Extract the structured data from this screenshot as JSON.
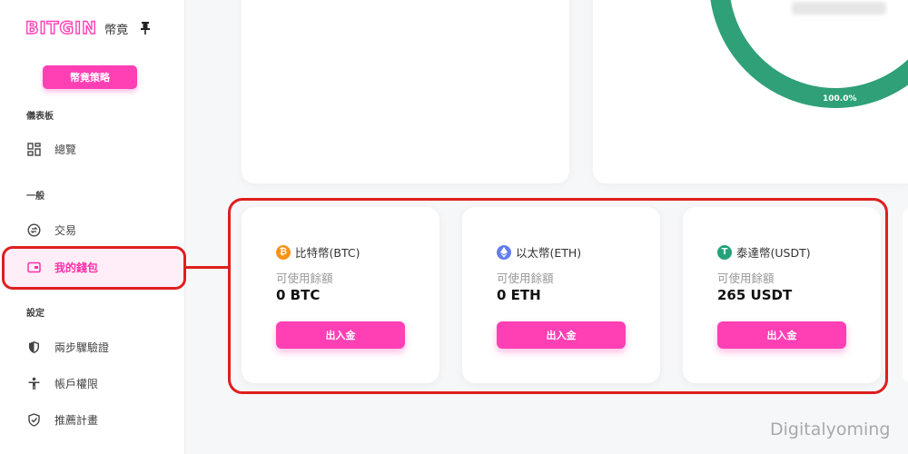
{
  "brand": {
    "logo": "BITGIN",
    "subtitle": "幣竟"
  },
  "sidebar": {
    "strategy_button": "幣竟策略",
    "sections": {
      "dashboard": "儀表板",
      "general": "一般",
      "settings": "設定"
    },
    "items": [
      {
        "label": "總覽",
        "icon": "grid-icon"
      },
      {
        "label": "交易",
        "icon": "exchange-icon"
      },
      {
        "label": "我的錢包",
        "icon": "wallet-icon",
        "active": true
      },
      {
        "label": "兩步驟驗證",
        "icon": "shield-icon"
      },
      {
        "label": "帳戶權限",
        "icon": "person-icon"
      },
      {
        "label": "推薦計畫",
        "icon": "shield-check-icon"
      }
    ]
  },
  "overview": {
    "percent": "100.0%"
  },
  "wallets": [
    {
      "coin": "比特幣(BTC)",
      "icon": "btc-icon",
      "color": "#f7931a",
      "balance_label": "可使用餘額",
      "amount": "0 BTC",
      "button": "出入金"
    },
    {
      "coin": "以太幣(ETH)",
      "icon": "eth-icon",
      "color": "#627eea",
      "balance_label": "可使用餘額",
      "amount": "0 ETH",
      "button": "出入金"
    },
    {
      "coin": "泰達幣(USDT)",
      "icon": "usdt-icon",
      "color": "#26a17b",
      "balance_label": "可使用餘額",
      "amount": "265 USDT",
      "button": "出入金"
    }
  ],
  "colors": {
    "accent": "#ff3fb4",
    "highlight": "#e01e1e",
    "donut": "#2fa077"
  },
  "watermark": "Digitalyoming"
}
